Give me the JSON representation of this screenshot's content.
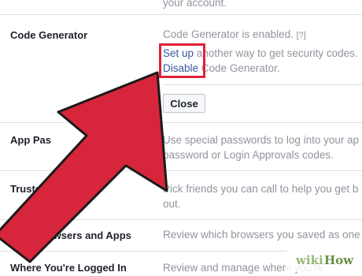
{
  "top_text": "your account.",
  "code_generator": {
    "label": "Code Generator",
    "status": "Code Generator is enabled.",
    "help": "[?]",
    "setup_link": "Set up",
    "setup_rest": "another way to get security codes.",
    "disable_link": "Disable",
    "disable_rest": "Code Generator.",
    "close_button": "Close"
  },
  "rows": [
    {
      "label": "App Pas",
      "desc1": "Use special passwords to log into your ap",
      "desc2": "password or Login Approvals codes."
    },
    {
      "label": "Trusted Co",
      "desc1": "Pick friends you can call to help you get b",
      "desc2": "out."
    },
    {
      "label": "Your Browsers and Apps",
      "desc1": "Review which browsers you saved as one",
      "desc2": ""
    },
    {
      "label": "Where You're Logged In",
      "desc1": "Review and manage where you're",
      "desc2": ""
    }
  ],
  "watermark": {
    "wiki": "wiki",
    "how": "How"
  },
  "colors": {
    "highlight": "#e0203a",
    "arrow": "#d7263b",
    "link": "#365899"
  }
}
